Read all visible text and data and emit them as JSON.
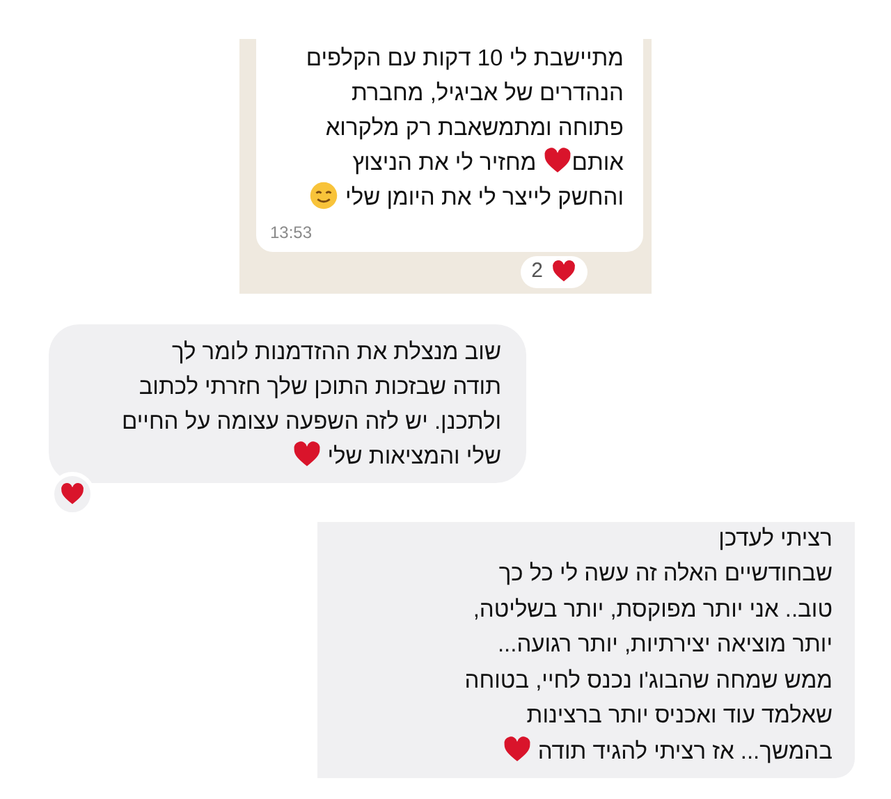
{
  "messages": [
    {
      "kind": "whatsapp",
      "lines": [
        [
          {
            "text": "מתיישבת לי 10 דקות עם הקלפים"
          }
        ],
        [
          {
            "text": "הנהדרים של אביגיל, מחברת"
          }
        ],
        [
          {
            "text": "פתוחה ומתמשאבת רק מלקרוא"
          }
        ],
        [
          {
            "text": "אותם"
          },
          {
            "kind": "heart"
          },
          {
            "text": " מחזיר לי את הניצוץ"
          }
        ],
        [
          {
            "text": "והחשק לייצר לי את היומן שלי "
          },
          {
            "kind": "smile"
          }
        ]
      ],
      "time": "13:53",
      "reaction": {
        "count": "2",
        "kind": "heart"
      }
    },
    {
      "kind": "bubble",
      "lines": [
        [
          {
            "text": "שוב מנצלת את ההזדמנות לומר לך"
          }
        ],
        [
          {
            "text": "תודה שבזכות התוכן שלך חזרתי לכתוב"
          }
        ],
        [
          {
            "text": "ולתכנן. יש לזה השפעה עצומה על החיים"
          }
        ],
        [
          {
            "text": "שלי והמציאות שלי "
          },
          {
            "kind": "heart"
          }
        ]
      ],
      "reaction": {
        "kind": "heart"
      }
    },
    {
      "kind": "bubble-cut",
      "lines": [
        [
          {
            "text": "רציתי לעדכן"
          }
        ],
        [
          {
            "text": "שבחודשיים האלה זה עשה לי כל כך"
          }
        ],
        [
          {
            "text": "טוב.. אני יותר מפוקסת, יותר בשליטה,"
          }
        ],
        [
          {
            "text": "יותר מוציאה יצירתיות, יותר רגועה..."
          }
        ],
        [
          {
            "text": "ממש שמחה שהבוג'ו נכנס לחיי, בטוחה"
          }
        ],
        [
          {
            "text": "שאלמד עוד ואכניס יותר ברצינות"
          }
        ],
        [
          {
            "text": "בהמשך... אז רציתי להגיד תודה "
          },
          {
            "kind": "heart"
          }
        ]
      ]
    }
  ]
}
